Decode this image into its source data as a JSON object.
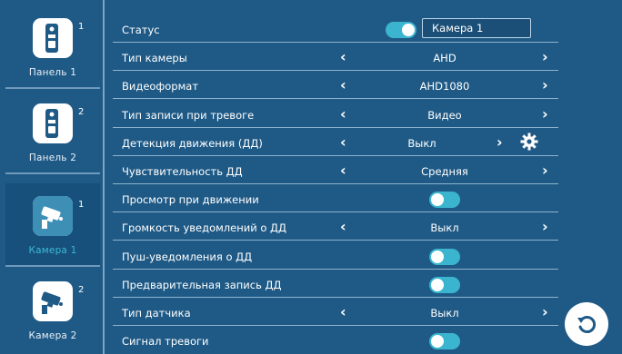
{
  "sidebar": {
    "items": [
      {
        "label": "Панель 1",
        "num": "1",
        "icon": "door-panel-icon",
        "active": false
      },
      {
        "label": "Панель 2",
        "num": "2",
        "icon": "door-panel-icon",
        "active": false
      },
      {
        "label": "Камера 1",
        "num": "1",
        "icon": "camera-icon",
        "active": true
      },
      {
        "label": "Камера 2",
        "num": "2",
        "icon": "camera-icon",
        "active": false
      }
    ]
  },
  "settings": {
    "status": {
      "label": "Статус",
      "value": "Камера 1",
      "on": true
    },
    "camera_type": {
      "label": "Тип камеры",
      "value": "AHD"
    },
    "video_format": {
      "label": "Видеоформат",
      "value": "AHD1080"
    },
    "alarm_record_type": {
      "label": "Тип записи при тревоге",
      "value": "Видео"
    },
    "motion_detection": {
      "label": "Детекция движения (ДД)",
      "value": "Выкл"
    },
    "md_sensitivity": {
      "label": "Чувствительность ДД",
      "value": "Средняя"
    },
    "view_on_motion": {
      "label": "Просмотр при движении",
      "on": true
    },
    "md_notify_volume": {
      "label": "Громкость уведомлений о ДД",
      "value": "Выкл"
    },
    "md_push": {
      "label": "Пуш-уведомления о ДД",
      "on": true
    },
    "md_prerecord": {
      "label": "Предварительная запись ДД",
      "on": true
    },
    "sensor_type": {
      "label": "Тип датчика",
      "value": "Выкл"
    },
    "alarm_signal": {
      "label": "Сигнал тревоги",
      "on": true
    }
  },
  "icons": {
    "back": "undo-icon",
    "gear": "gear-icon",
    "left": "chevron-left-icon",
    "right": "chevron-right-icon"
  },
  "colors": {
    "background": "#1f5a86",
    "accent": "#3bb5cf",
    "divider": "#8fb3cd"
  }
}
